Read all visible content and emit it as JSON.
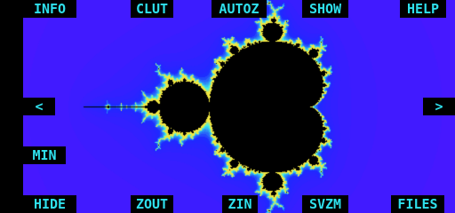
{
  "app": {
    "buttons": {
      "info": "INFO",
      "clut": "CLUT",
      "autoz": "AUTOZ",
      "show": "SHOW",
      "help": "HELP",
      "left": "<",
      "right": ">",
      "min": "MIN",
      "hide": "HIDE",
      "zout": "ZOUT",
      "zin": "ZIN",
      "svzm": "SVZM",
      "files": "FILES"
    },
    "colors": {
      "background": "#000000",
      "button_text": "#2fe0ec",
      "fractal_outer": "#4a1cff",
      "fractal_inner_glow": "#2233ff",
      "fractal_edge_cyan": "#38e6f0",
      "fractal_edge_yellow": "#e8e84a",
      "set_interior": "#000000"
    }
  }
}
